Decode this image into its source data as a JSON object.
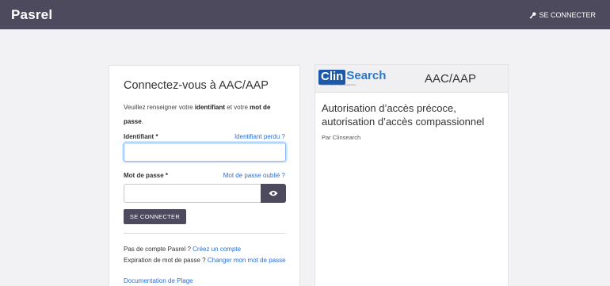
{
  "header": {
    "brand": "Pasrel",
    "login_label": "SE CONNECTER",
    "login_icon": "key-icon"
  },
  "login": {
    "title": "Connectez-vous à AAC/AAP",
    "intro_prefix": "Veuillez renseigner votre ",
    "intro_bold1": "identifiant",
    "intro_middle": " et votre ",
    "intro_bold2": "mot de passe",
    "intro_suffix": ".",
    "identifiant_label": "Identifiant *",
    "identifiant_lost_link": "Identifiant perdu ?",
    "identifiant_value": "",
    "password_label": "Mot de passe *",
    "password_lost_link": "Mot de passe oublié ?",
    "password_value": "",
    "eye_icon": "eye-icon",
    "submit_label": "SE CONNECTER",
    "no_account_text": "Pas de compte Pasrel ? ",
    "create_account_link": "Créez un compte",
    "expired_text": "Expiration de mot de passe ? ",
    "change_password_link": "Changer mon mot de passe",
    "documentation_link": "Documentation de Plage"
  },
  "info": {
    "logo_box": "Clin",
    "logo_rest": "Search",
    "logo_tagline": "Scientific and Innovative Solutions",
    "brand": "AAC/AAP",
    "title": "Autorisation d’accès précoce, autorisation d’accès compassionnel",
    "by": "Par Clinsearch"
  },
  "colors": {
    "topbar": "#4d4a5d",
    "link": "#2b6fd8",
    "logo_dark": "#1e58a8",
    "logo_light": "#2a78c8"
  }
}
